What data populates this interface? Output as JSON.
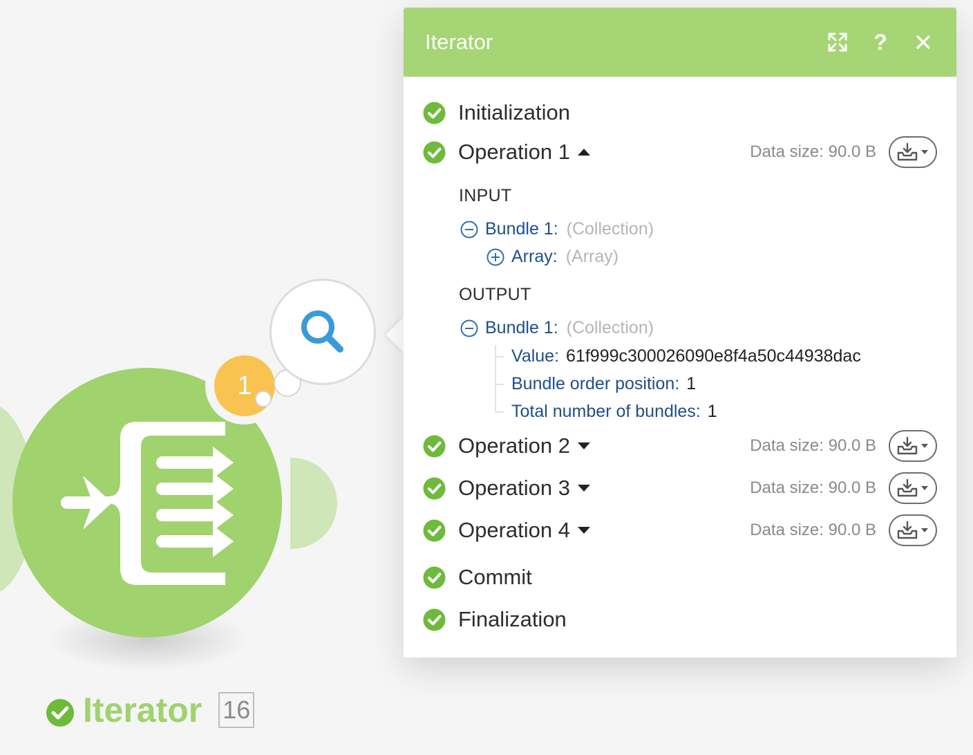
{
  "module": {
    "name": "Iterator",
    "operations_badge": "1",
    "count_badge": "16",
    "color": "#a0d26e"
  },
  "panel": {
    "title": "Iterator",
    "header_color": "#a5d574",
    "header_icons": [
      "expand-icon",
      "help-icon",
      "close-icon"
    ],
    "help_label": "?",
    "rows": {
      "initialization": "Initialization",
      "op1": {
        "label": "Operation 1",
        "data_size": "Data size: 90.0 B",
        "expanded": true
      },
      "op2": {
        "label": "Operation 2",
        "data_size": "Data size: 90.0 B",
        "expanded": false
      },
      "op3": {
        "label": "Operation 3",
        "data_size": "Data size: 90.0 B",
        "expanded": false
      },
      "op4": {
        "label": "Operation 4",
        "data_size": "Data size: 90.0 B",
        "expanded": false
      },
      "commit": "Commit",
      "finalization": "Finalization"
    },
    "input": {
      "heading": "INPUT",
      "bundle_key": "Bundle 1:",
      "bundle_type": "(Collection)",
      "array_key": "Array:",
      "array_type": "(Array)"
    },
    "output": {
      "heading": "OUTPUT",
      "bundle_key": "Bundle 1:",
      "bundle_type": "(Collection)",
      "value_key": "Value:",
      "value": "61f999c300026090e8f4a50c44938dac",
      "position_key": "Bundle order position:",
      "position": "1",
      "total_key": "Total number of bundles:",
      "total": "1"
    },
    "status_color": "#6dba3c"
  }
}
